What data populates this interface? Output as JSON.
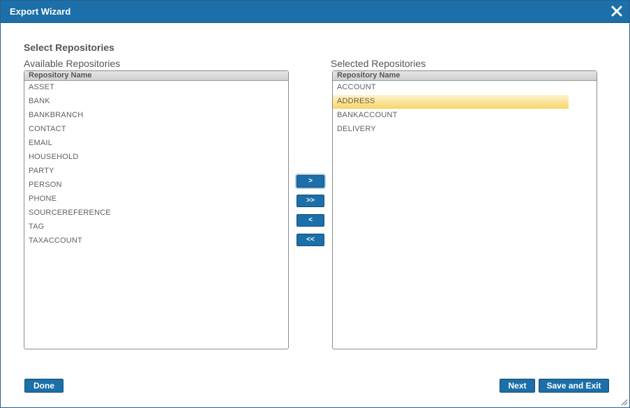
{
  "dialog": {
    "title": "Export Wizard",
    "close_icon": "close-icon",
    "section_title": "Select Repositories"
  },
  "available": {
    "label": "Available Repositories",
    "column_header": "Repository Name",
    "items": [
      "ASSET",
      "BANK",
      "BANKBRANCH",
      "CONTACT",
      "EMAIL",
      "HOUSEHOLD",
      "PARTY",
      "PERSON",
      "PHONE",
      "SOURCEREFERENCE",
      "TAG",
      "TAXACCOUNT"
    ]
  },
  "selected": {
    "label": "Selected Repositories",
    "column_header": "Repository Name",
    "items": [
      "ACCOUNT",
      "ADDRESS",
      "BANKACCOUNT",
      "DELIVERY"
    ],
    "highlighted_item": "ADDRESS"
  },
  "transfer": {
    "add_one": ">",
    "add_all": ">>",
    "remove_one": "<",
    "remove_all": "<<"
  },
  "footer": {
    "done_label": "Done",
    "next_label": "Next",
    "save_exit_label": "Save and Exit"
  },
  "colors": {
    "titlebar": "#1c6fa8",
    "button": "#1c6fa8",
    "highlight": "#fbe59a"
  }
}
